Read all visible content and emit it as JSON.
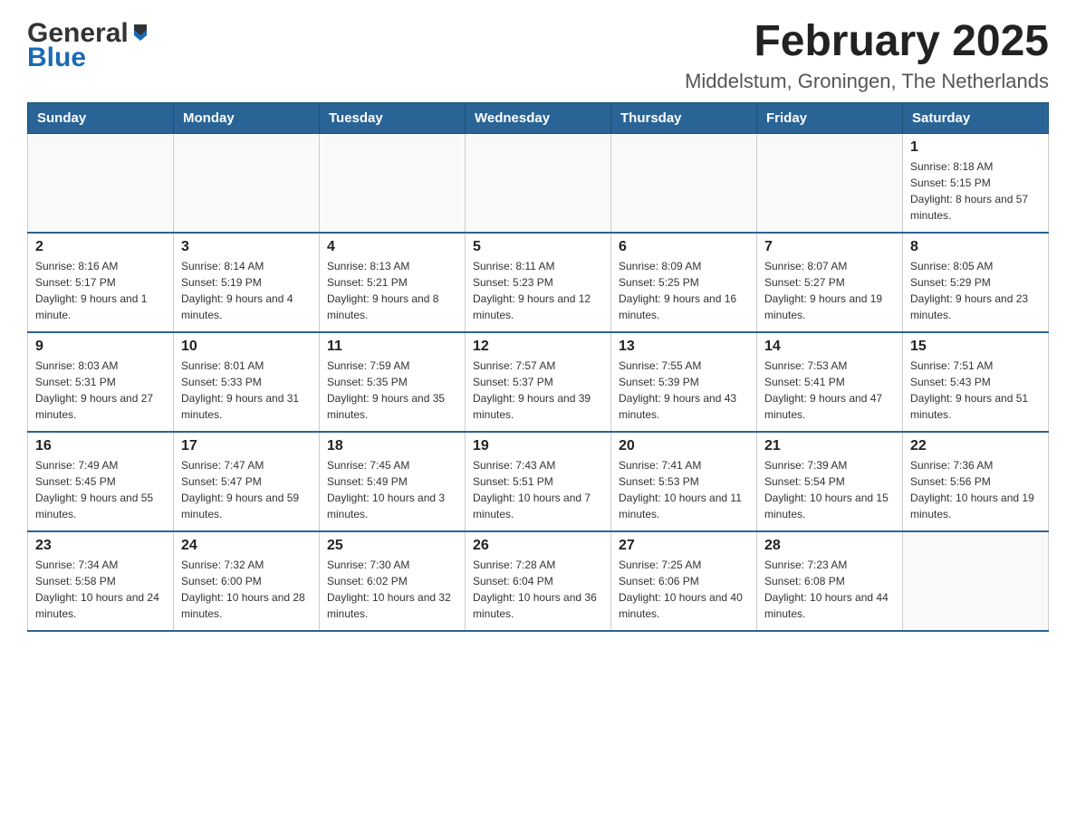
{
  "logo": {
    "general": "General",
    "blue": "Blue"
  },
  "title": {
    "month": "February 2025",
    "location": "Middelstum, Groningen, The Netherlands"
  },
  "weekdays": [
    "Sunday",
    "Monday",
    "Tuesday",
    "Wednesday",
    "Thursday",
    "Friday",
    "Saturday"
  ],
  "weeks": [
    [
      {
        "day": "",
        "info": ""
      },
      {
        "day": "",
        "info": ""
      },
      {
        "day": "",
        "info": ""
      },
      {
        "day": "",
        "info": ""
      },
      {
        "day": "",
        "info": ""
      },
      {
        "day": "",
        "info": ""
      },
      {
        "day": "1",
        "info": "Sunrise: 8:18 AM\nSunset: 5:15 PM\nDaylight: 8 hours and 57 minutes."
      }
    ],
    [
      {
        "day": "2",
        "info": "Sunrise: 8:16 AM\nSunset: 5:17 PM\nDaylight: 9 hours and 1 minute."
      },
      {
        "day": "3",
        "info": "Sunrise: 8:14 AM\nSunset: 5:19 PM\nDaylight: 9 hours and 4 minutes."
      },
      {
        "day": "4",
        "info": "Sunrise: 8:13 AM\nSunset: 5:21 PM\nDaylight: 9 hours and 8 minutes."
      },
      {
        "day": "5",
        "info": "Sunrise: 8:11 AM\nSunset: 5:23 PM\nDaylight: 9 hours and 12 minutes."
      },
      {
        "day": "6",
        "info": "Sunrise: 8:09 AM\nSunset: 5:25 PM\nDaylight: 9 hours and 16 minutes."
      },
      {
        "day": "7",
        "info": "Sunrise: 8:07 AM\nSunset: 5:27 PM\nDaylight: 9 hours and 19 minutes."
      },
      {
        "day": "8",
        "info": "Sunrise: 8:05 AM\nSunset: 5:29 PM\nDaylight: 9 hours and 23 minutes."
      }
    ],
    [
      {
        "day": "9",
        "info": "Sunrise: 8:03 AM\nSunset: 5:31 PM\nDaylight: 9 hours and 27 minutes."
      },
      {
        "day": "10",
        "info": "Sunrise: 8:01 AM\nSunset: 5:33 PM\nDaylight: 9 hours and 31 minutes."
      },
      {
        "day": "11",
        "info": "Sunrise: 7:59 AM\nSunset: 5:35 PM\nDaylight: 9 hours and 35 minutes."
      },
      {
        "day": "12",
        "info": "Sunrise: 7:57 AM\nSunset: 5:37 PM\nDaylight: 9 hours and 39 minutes."
      },
      {
        "day": "13",
        "info": "Sunrise: 7:55 AM\nSunset: 5:39 PM\nDaylight: 9 hours and 43 minutes."
      },
      {
        "day": "14",
        "info": "Sunrise: 7:53 AM\nSunset: 5:41 PM\nDaylight: 9 hours and 47 minutes."
      },
      {
        "day": "15",
        "info": "Sunrise: 7:51 AM\nSunset: 5:43 PM\nDaylight: 9 hours and 51 minutes."
      }
    ],
    [
      {
        "day": "16",
        "info": "Sunrise: 7:49 AM\nSunset: 5:45 PM\nDaylight: 9 hours and 55 minutes."
      },
      {
        "day": "17",
        "info": "Sunrise: 7:47 AM\nSunset: 5:47 PM\nDaylight: 9 hours and 59 minutes."
      },
      {
        "day": "18",
        "info": "Sunrise: 7:45 AM\nSunset: 5:49 PM\nDaylight: 10 hours and 3 minutes."
      },
      {
        "day": "19",
        "info": "Sunrise: 7:43 AM\nSunset: 5:51 PM\nDaylight: 10 hours and 7 minutes."
      },
      {
        "day": "20",
        "info": "Sunrise: 7:41 AM\nSunset: 5:53 PM\nDaylight: 10 hours and 11 minutes."
      },
      {
        "day": "21",
        "info": "Sunrise: 7:39 AM\nSunset: 5:54 PM\nDaylight: 10 hours and 15 minutes."
      },
      {
        "day": "22",
        "info": "Sunrise: 7:36 AM\nSunset: 5:56 PM\nDaylight: 10 hours and 19 minutes."
      }
    ],
    [
      {
        "day": "23",
        "info": "Sunrise: 7:34 AM\nSunset: 5:58 PM\nDaylight: 10 hours and 24 minutes."
      },
      {
        "day": "24",
        "info": "Sunrise: 7:32 AM\nSunset: 6:00 PM\nDaylight: 10 hours and 28 minutes."
      },
      {
        "day": "25",
        "info": "Sunrise: 7:30 AM\nSunset: 6:02 PM\nDaylight: 10 hours and 32 minutes."
      },
      {
        "day": "26",
        "info": "Sunrise: 7:28 AM\nSunset: 6:04 PM\nDaylight: 10 hours and 36 minutes."
      },
      {
        "day": "27",
        "info": "Sunrise: 7:25 AM\nSunset: 6:06 PM\nDaylight: 10 hours and 40 minutes."
      },
      {
        "day": "28",
        "info": "Sunrise: 7:23 AM\nSunset: 6:08 PM\nDaylight: 10 hours and 44 minutes."
      },
      {
        "day": "",
        "info": ""
      }
    ]
  ]
}
